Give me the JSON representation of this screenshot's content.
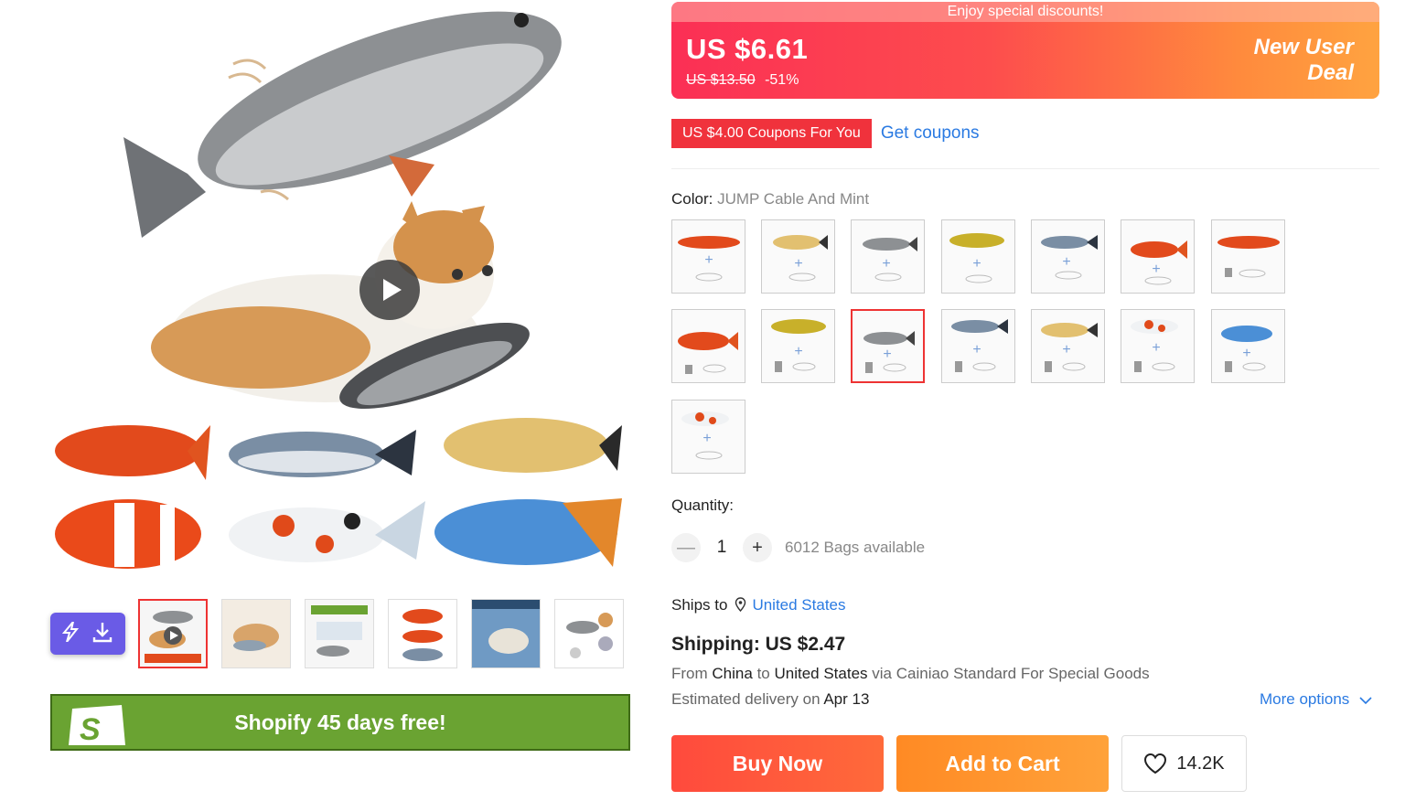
{
  "price": {
    "promo_banner": "Enjoy special discounts!",
    "current": "US $6.61",
    "original": "US $13.50",
    "discount": "-51%",
    "deal_line1": "New User",
    "deal_line2": "Deal"
  },
  "coupon": {
    "tag": "US $4.00 Coupons For You",
    "link": "Get coupons"
  },
  "color": {
    "label": "Color:",
    "selected": "JUMP Cable And Mint",
    "swatch_count": 15,
    "selected_index": 9
  },
  "quantity": {
    "label": "Quantity:",
    "minus": "—",
    "plus": "+",
    "value": "1",
    "available": "6012 Bags available"
  },
  "shipping": {
    "ships_to_label": "Ships to",
    "ships_to_country": "United States",
    "price": "Shipping: US $2.47",
    "from_prefix": "From",
    "from_country": "China",
    "to_word": "to",
    "to_country": "United States",
    "via_text": "via Cainiao Standard For Special Goods",
    "delivery_prefix": "Estimated delivery on",
    "delivery_date": "Apr 13",
    "more_options": "More options"
  },
  "actions": {
    "buy_now": "Buy Now",
    "add_to_cart": "Add to Cart",
    "wishlist_count": "14.2K"
  },
  "gallery": {
    "thumbnail_count": 6,
    "active_thumbnail": 0
  },
  "promo": {
    "shopify_text": "Shopify 45 days free!"
  },
  "icons": {
    "play": "play-icon",
    "download": "download-icon",
    "bolt": "bolt-icon",
    "location": "location-pin-icon",
    "chevron": "chevron-down-icon",
    "heart": "heart-icon"
  },
  "colors": {
    "accent_red": "#f0323c",
    "link_blue": "#2a7ae2",
    "cart_orange": "#ff9a30",
    "shopify_green": "#6aa332"
  }
}
